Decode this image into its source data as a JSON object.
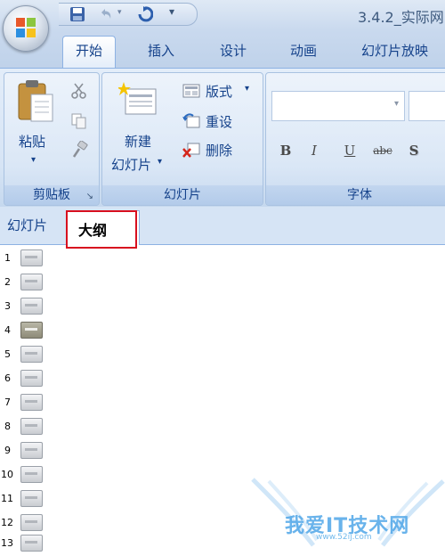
{
  "window": {
    "title": "3.4.2_实际网"
  },
  "quick_access": {
    "icons": [
      "save-icon",
      "undo-icon",
      "redo-icon",
      "customize-dropdown-icon"
    ]
  },
  "ribbon_tabs": [
    {
      "label": "开始",
      "active": true
    },
    {
      "label": "插入",
      "active": false
    },
    {
      "label": "设计",
      "active": false
    },
    {
      "label": "动画",
      "active": false
    },
    {
      "label": "幻灯片放映",
      "active": false
    }
  ],
  "clipboard": {
    "group_label": "剪贴板",
    "paste_label": "粘贴",
    "paste_arrow": "▾",
    "launcher": "↘"
  },
  "slides": {
    "group_label": "幻灯片",
    "new_slide_line1": "新建",
    "new_slide_line2": "幻灯片",
    "new_slide_arrow": "▾",
    "layout_label": "版式",
    "layout_arrow": "▾",
    "reset_label": "重设",
    "delete_label": "删除"
  },
  "font": {
    "group_label": "字体",
    "combo_arrow": "▾",
    "buttons": [
      "B",
      "I",
      "U",
      "abc",
      "S"
    ]
  },
  "pane_tabs": {
    "slides_tab": "幻灯片",
    "outline_tab": "大纲"
  },
  "outline": {
    "rows": [
      {
        "num": "1",
        "selected": false
      },
      {
        "num": "2",
        "selected": false
      },
      {
        "num": "3",
        "selected": false
      },
      {
        "num": "4",
        "selected": true
      },
      {
        "num": "5",
        "selected": false
      },
      {
        "num": "6",
        "selected": false
      },
      {
        "num": "7",
        "selected": false
      },
      {
        "num": "8",
        "selected": false
      },
      {
        "num": "9",
        "selected": false
      },
      {
        "num": "10",
        "selected": false
      },
      {
        "num": "11",
        "selected": false
      },
      {
        "num": "12",
        "selected": false
      },
      {
        "num": "13",
        "selected": false
      }
    ]
  },
  "watermark": {
    "text": "我爱IT技术网",
    "url": "www.52ij.com"
  },
  "colors": {
    "accent": "#15428b",
    "ribbon": "#d6e4f5",
    "highlight": "#d80f1f"
  }
}
